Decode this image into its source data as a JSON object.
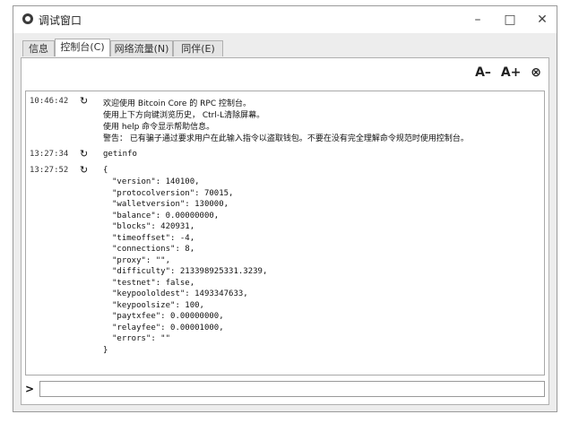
{
  "window": {
    "title": "调试窗口",
    "min": "–",
    "max": "□",
    "close": "✕"
  },
  "tabs": [
    "信息",
    "控制台(C)",
    "网络流量(N)",
    "同伴(E)"
  ],
  "font_tools": {
    "decrease": "A–",
    "increase": "A+",
    "clear": "⊗"
  },
  "console": {
    "entries": [
      {
        "time": "10:46:42",
        "dir": "↻",
        "lines": [
          "欢迎使用 Bitcoin Core 的 RPC 控制台。",
          "使用上下方向键浏览历史， Ctrl-L清除屏幕。",
          "使用 help 命令显示帮助信息。",
          "警告： 已有骗子通过要求用户在此输入指令以盗取钱包。不要在没有完全理解命令规范时使用控制台。"
        ]
      },
      {
        "time": "13:27:34",
        "dir": "↻",
        "lines": [
          "getinfo"
        ]
      },
      {
        "time": "13:27:52",
        "dir": "↻",
        "lines": [
          "{"
        ]
      }
    ],
    "json": [
      "\"version\": 140100,",
      "\"protocolversion\": 70015,",
      "\"walletversion\": 130000,",
      "\"balance\": 0.00000000,",
      "\"blocks\": 420931,",
      "\"timeoffset\": -4,",
      "\"connections\": 8,",
      "\"proxy\": \"\",",
      "\"difficulty\": 213398925331.3239,",
      "\"testnet\": false,",
      "\"keypoololdest\": 1493347633,",
      "\"keypoolsize\": 100,",
      "\"paytxfee\": 0.00000000,",
      "\"relayfee\": 0.00001000,",
      "\"errors\": \"\"",
      "}"
    ]
  },
  "input": {
    "prompt": ">",
    "value": ""
  }
}
